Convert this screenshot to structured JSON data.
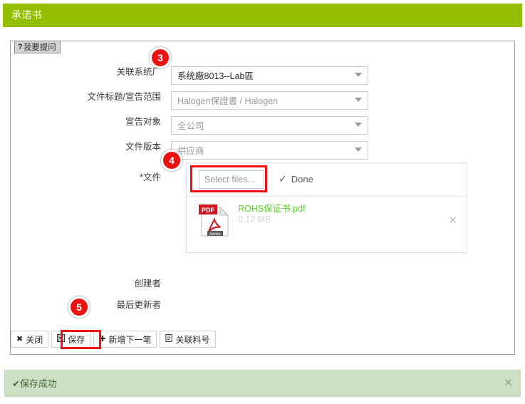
{
  "header": {
    "title": "承诺书",
    "bar_color": "#93bf00"
  },
  "tab": {
    "icon": "question-mark-icon",
    "icon_glyph": "?",
    "label": "我要提问"
  },
  "form": {
    "fields": [
      {
        "label": "关联系统厂",
        "required": false,
        "value": "系统廠8013--Lab區",
        "filled": true,
        "caret": "chevron-down-icon"
      },
      {
        "label": "文件标题/宣告范围",
        "required": false,
        "value": "Halogen保證書 / Halogen",
        "filled": false,
        "caret": "chevron-down-icon"
      },
      {
        "label": "宣告对象",
        "required": false,
        "value": "全公司",
        "filled": false,
        "caret": "chevron-down-icon"
      },
      {
        "label": "文件版本",
        "required": false,
        "value": "供应商",
        "filled": false,
        "caret": "chevron-down-icon"
      }
    ],
    "file_field": {
      "label": "文件",
      "required_marker": "*",
      "select_files_label": "Select files...",
      "status_check": "✓",
      "status_label": "Done",
      "files": [
        {
          "icon": "pdf-file-icon",
          "icon_badge": "PDF",
          "icon_brand": "Adobe",
          "name": "ROHS保证书.pdf",
          "size": "0.12 MB",
          "name_color": "#5bd12a",
          "remove_icon": "close-icon",
          "remove_glyph": "✕"
        }
      ]
    },
    "meta": [
      {
        "label": "创建者",
        "value": ""
      },
      {
        "label": "最后更新者",
        "value": ""
      }
    ]
  },
  "buttons": [
    {
      "icon": "close-x-icon",
      "glyph": "✖",
      "label": "关闭"
    },
    {
      "icon": "save-disk-icon",
      "glyph": "💾",
      "label": "保存"
    },
    {
      "icon": "plus-icon",
      "glyph": "✚",
      "label": "新增下一笔"
    },
    {
      "icon": "document-link-icon",
      "glyph": "🗎",
      "label": "关联料号"
    }
  ],
  "steps": [
    {
      "number": "3"
    },
    {
      "number": "4"
    },
    {
      "number": "5"
    }
  ],
  "alert": {
    "icon": "check-icon",
    "glyph": "✔",
    "message": "保存成功",
    "close_icon": "close-icon",
    "close_glyph": "✕",
    "bg_color": "#cde0c4"
  },
  "highlight_color": "#ee1111"
}
